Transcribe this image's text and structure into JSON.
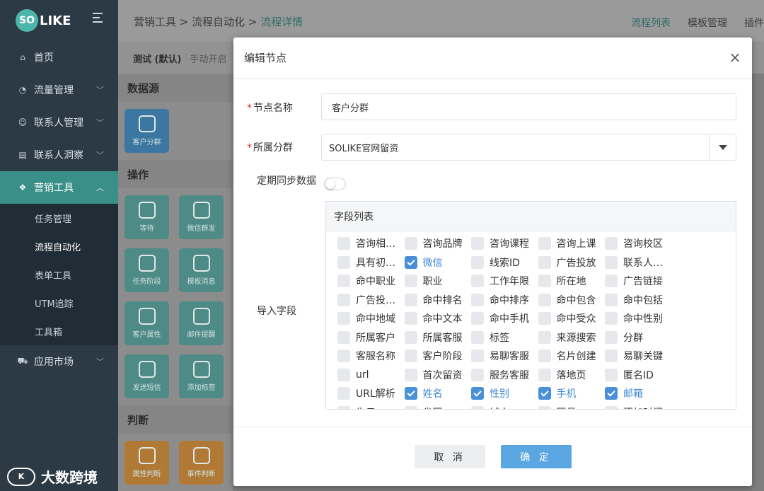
{
  "brand": {
    "mark": "SO",
    "name": "LIKE"
  },
  "sidebar": {
    "items": [
      {
        "label": "首页",
        "icon": "home-icon",
        "glyph": "⌂"
      },
      {
        "label": "流量管理",
        "icon": "pie-chart-icon",
        "glyph": "◔"
      },
      {
        "label": "联系人管理",
        "icon": "users-icon",
        "glyph": "☺"
      },
      {
        "label": "联系人洞察",
        "icon": "id-card-icon",
        "glyph": "▤"
      },
      {
        "label": "营销工具",
        "icon": "cubes-icon",
        "glyph": "❖"
      },
      {
        "label": "应用市场",
        "icon": "cart-icon",
        "glyph": "⛟"
      }
    ],
    "sub_items": [
      "任务管理",
      "流程自动化",
      "表单工具",
      "UTM追踪",
      "工具箱"
    ]
  },
  "watermark": {
    "icon_text": "K",
    "text": "大数跨境"
  },
  "topbar": {
    "breadcrumb": [
      "营销工具",
      "流程自动化",
      "流程详情"
    ],
    "links": [
      "流程列表",
      "模板管理",
      "插件"
    ]
  },
  "subbar": {
    "name": "测试 (默认)",
    "mode": "手动开启"
  },
  "panel": {
    "sections": [
      "数据源",
      "操作",
      "判断"
    ],
    "source_tiles": [
      "客户分群"
    ],
    "action_tiles": [
      "等待",
      "微信群发",
      "任务阶段",
      "模板消息",
      "客户属性",
      "邮件提醒",
      "发送短信",
      "添加标签"
    ],
    "judge_tiles": [
      "属性判断",
      "事件判断"
    ]
  },
  "modal": {
    "title": "编辑节点",
    "close": "×",
    "node_name_label": "节点名称",
    "node_name_value": "客户分群",
    "group_label": "所属分群",
    "group_value": "SOLIKE官网留资",
    "sync_label": "定期同步数据",
    "sync_on": false,
    "import_label": "导入字段",
    "field_list_title": "字段列表",
    "fields": [
      {
        "label": "咨询相关信息",
        "checked": false
      },
      {
        "label": "咨询品牌",
        "checked": false
      },
      {
        "label": "咨询课程",
        "checked": false
      },
      {
        "label": "咨询上课",
        "checked": false
      },
      {
        "label": "咨询校区",
        "checked": false
      },
      {
        "label": "具有初步意向",
        "checked": false
      },
      {
        "label": "微信",
        "checked": true
      },
      {
        "label": "线索ID",
        "checked": false
      },
      {
        "label": "广告投放",
        "checked": false
      },
      {
        "label": "联系人来源",
        "checked": false
      },
      {
        "label": "命中职业",
        "checked": false
      },
      {
        "label": "职业",
        "checked": false
      },
      {
        "label": "工作年限",
        "checked": false
      },
      {
        "label": "所在地",
        "checked": false
      },
      {
        "label": "广告链接",
        "checked": false
      },
      {
        "label": "广告投放渠道",
        "checked": false
      },
      {
        "label": "命中排名",
        "checked": false
      },
      {
        "label": "命中排序",
        "checked": false
      },
      {
        "label": "命中包含",
        "checked": false
      },
      {
        "label": "命中包括",
        "checked": false
      },
      {
        "label": "命中地域",
        "checked": false
      },
      {
        "label": "命中文本",
        "checked": false
      },
      {
        "label": "命中手机",
        "checked": false
      },
      {
        "label": "命中受众",
        "checked": false
      },
      {
        "label": "命中性别",
        "checked": false
      },
      {
        "label": "所属客户",
        "checked": false
      },
      {
        "label": "所属客服",
        "checked": false
      },
      {
        "label": "标签",
        "checked": false
      },
      {
        "label": "来源搜索",
        "checked": false
      },
      {
        "label": "分群",
        "checked": false
      },
      {
        "label": "客服名称",
        "checked": false
      },
      {
        "label": "客户阶段",
        "checked": false
      },
      {
        "label": "易聊客服",
        "checked": false
      },
      {
        "label": "名片创建",
        "checked": false
      },
      {
        "label": "易聊关键",
        "checked": false
      },
      {
        "label": "url",
        "checked": false
      },
      {
        "label": "首次留资",
        "checked": false
      },
      {
        "label": "服务客服",
        "checked": false
      },
      {
        "label": "落地页",
        "checked": false
      },
      {
        "label": "匿名ID",
        "checked": false
      },
      {
        "label": "URL解析",
        "checked": false
      },
      {
        "label": "姓名",
        "checked": true
      },
      {
        "label": "性别",
        "checked": true
      },
      {
        "label": "手机",
        "checked": true
      },
      {
        "label": "邮箱",
        "checked": true
      },
      {
        "label": "生日",
        "checked": false
      },
      {
        "label": "省区",
        "checked": false
      },
      {
        "label": "城市",
        "checked": false
      },
      {
        "label": "区县",
        "checked": false
      },
      {
        "label": "添加时间",
        "checked": false
      }
    ],
    "cancel_label": "取 消",
    "ok_label": "确 定"
  }
}
